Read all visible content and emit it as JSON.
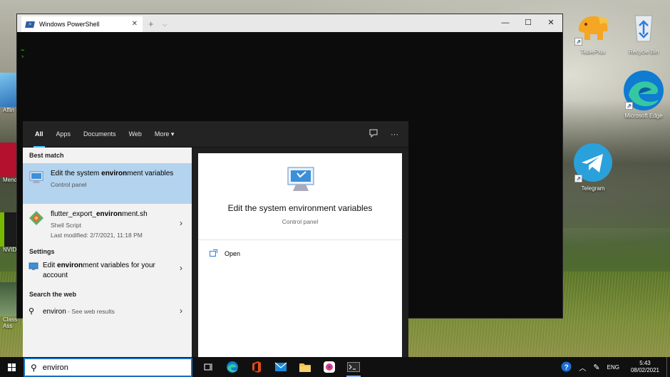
{
  "desktop": {
    "icons_right": [
      {
        "name": "tableplus",
        "label": "TablePlus",
        "icon": "tableplus-elephant-icon",
        "shortcut": true
      },
      {
        "name": "recycle-bin",
        "label": "Recycle Bin",
        "icon": "recycle-bin-icon",
        "shortcut": false
      },
      {
        "name": "microsoft-edge",
        "label": "Microsoft Edge",
        "icon": "edge-icon",
        "shortcut": true
      },
      {
        "name": "telegram",
        "label": "Telegram",
        "icon": "telegram-icon",
        "shortcut": true
      }
    ],
    "icons_left_partial": [
      {
        "label": "Affin"
      },
      {
        "label": "Mend"
      },
      {
        "label": "NVID"
      },
      {
        "label": "Class Ass"
      }
    ]
  },
  "powershell": {
    "tab_title": "Windows PowerShell",
    "tab_close": "✕",
    "new_tab": "+",
    "dropdown": "⌵",
    "minimize": "—",
    "maximize": "☐",
    "close": "✕",
    "lines": [
      "~",
      "›"
    ]
  },
  "search": {
    "tabs": [
      "All",
      "Apps",
      "Documents",
      "Web",
      "More ▾"
    ],
    "active_tab": "All",
    "sections": {
      "best_match": "Best match",
      "settings": "Settings",
      "search_web": "Search the web"
    },
    "best_match": {
      "title_pre": "Edit the system ",
      "title_bold": "environ",
      "title_post": "ment variables",
      "subtitle": "Control panel"
    },
    "file_result": {
      "title_pre": "flutter_export_",
      "title_bold": "environ",
      "title_post": "ment.sh",
      "type": "Shell Script",
      "modified": "Last modified: 2/7/2021, 11:18 PM"
    },
    "settings_result": {
      "title_pre": "Edit ",
      "title_bold": "environ",
      "title_post": "ment variables for your account"
    },
    "web_result": {
      "query": "environ",
      "suffix": " - See web results"
    },
    "preview": {
      "title": "Edit the system environment variables",
      "subtitle": "Control panel",
      "action_open": "Open"
    }
  },
  "taskbar": {
    "search_value": "environ",
    "apps": [
      "task-view-icon",
      "edge-icon",
      "office-icon",
      "mail-icon",
      "file-explorer-icon",
      "color-picker-icon",
      "terminal-icon"
    ],
    "tray": {
      "lang": "ENG",
      "time": "5:43",
      "date": "08/02/2021"
    }
  },
  "colors": {
    "accent": "#4cc2ff",
    "selected": "#b3d3ee",
    "taskbar": "#101010",
    "terminal_bg": "#0c0c0c",
    "prompt_green": "#16c60c"
  }
}
